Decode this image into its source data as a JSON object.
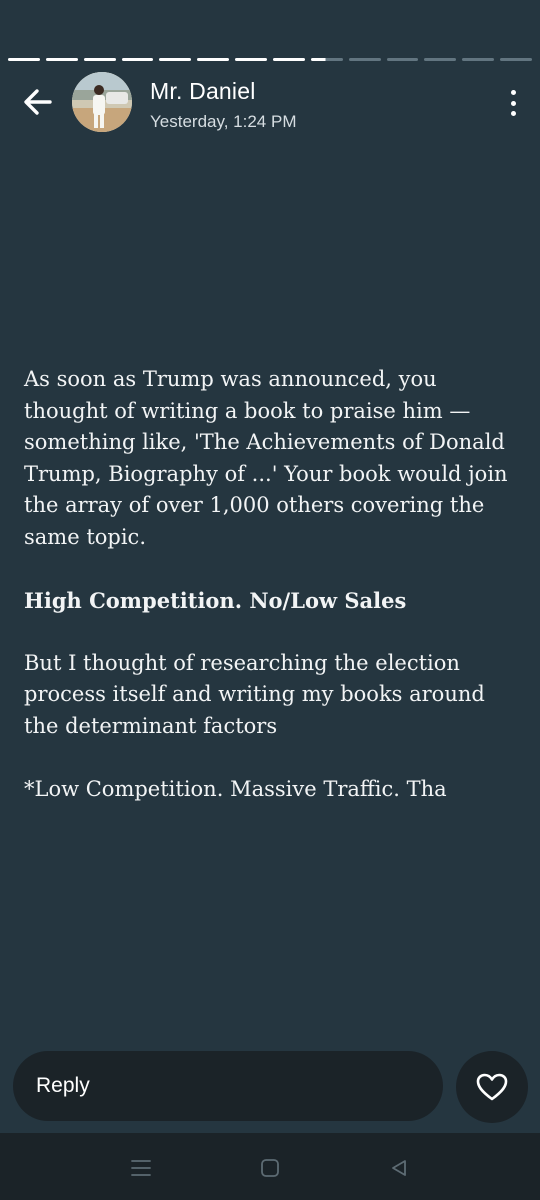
{
  "status": {
    "segments": [
      "viewed",
      "viewed",
      "viewed",
      "viewed",
      "viewed",
      "viewed",
      "viewed",
      "viewed",
      "active",
      "pending",
      "pending",
      "pending",
      "pending",
      "pending"
    ],
    "active_progress": 0.45
  },
  "header": {
    "name": "Mr. Daniel",
    "timestamp": "Yesterday, 1:24 PM",
    "back_icon": "arrow-left-icon",
    "menu_icon": "more-vertical-icon"
  },
  "message": {
    "paragraph1": "As soon as Trump was announced, you thought of writing a book to praise him —something like, 'The Achievements of Donald Trump, Biography of ...' Your book would join the array of over 1,000 others covering the same topic.",
    "heading": "High Competition. No/Low Sales",
    "paragraph2": "But I thought of researching the election process itself and writing my books around the determinant factors",
    "paragraph3": "*Low Competition. Massive Traffic. Tha"
  },
  "footer": {
    "reply_placeholder": "Reply",
    "like_icon": "heart-icon"
  },
  "navbar": {
    "icons": [
      "menu-icon",
      "home-square-icon",
      "back-triangle-icon"
    ]
  },
  "colors": {
    "background": "#253640",
    "input_background": "#1b2328",
    "text": "#ffffff"
  }
}
